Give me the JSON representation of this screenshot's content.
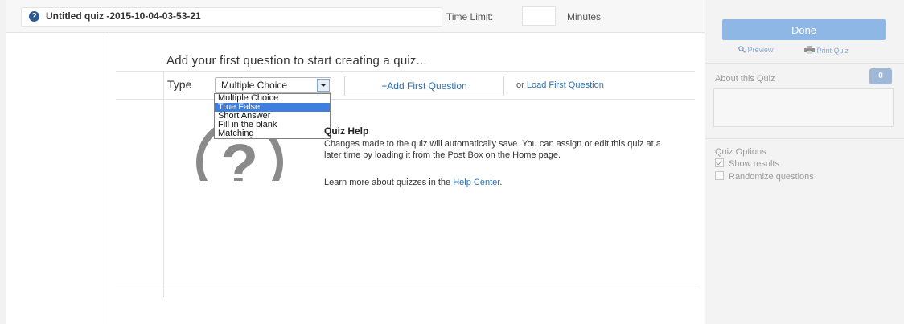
{
  "header": {
    "quiz_title": "Untitled quiz -2015-10-04-03-53-21",
    "time_limit_label": "Time Limit:",
    "time_limit_value": "",
    "minutes_label": "Minutes"
  },
  "main": {
    "heading": "Add your first question to start creating a quiz...",
    "type_label": "Type",
    "type_select": {
      "selected": "Multiple Choice",
      "options": [
        "Multiple Choice",
        "True False",
        "Short Answer",
        "Fill in the blank",
        "Matching"
      ],
      "highlighted": "True False"
    },
    "add_first_question": "+Add First Question",
    "or_text": "or",
    "load_first_question": "Load First Question",
    "help": {
      "title": "Quiz Help",
      "body": "Changes made to the quiz will automatically save. You can assign or edit this quiz at a later time by loading it from the Post Box on the Home page.",
      "learn_more_prefix": "Learn more about quizzes in the",
      "help_center_link": "Help Center",
      "suffix": "."
    }
  },
  "sidebar": {
    "done_label": "Done",
    "preview_label": "Preview",
    "print_label": "Print Quiz",
    "about_label": "About this Quiz",
    "question_count": "0",
    "options_label": "Quiz Options",
    "show_results": {
      "label": "Show results",
      "checked": true
    },
    "randomize": {
      "label": "Randomize questions",
      "checked": false
    }
  },
  "colors": {
    "accent": "#2f6fb3",
    "done_button": "#8eb7e6",
    "selected_option": "#3d7ede"
  },
  "icons": [
    "question-icon",
    "help-question-icon",
    "chevron-down-icon",
    "magnifier-icon",
    "printer-icon"
  ]
}
